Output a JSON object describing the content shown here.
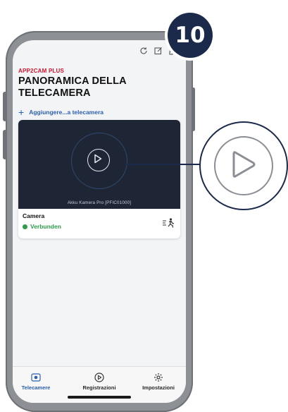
{
  "step_number": "10",
  "toolbar": {
    "icons": [
      "refresh-icon",
      "edit-icon",
      "grid-icon"
    ]
  },
  "header": {
    "app_name": "APP2CAM PLUS",
    "title": "PANORAMICA DELLA TELECAMERA"
  },
  "add_camera": {
    "label": "Aggiungere...a telecamera"
  },
  "camera_card": {
    "preview_caption": "Akku Kamera Pro [PFIC01000]",
    "name": "Camera",
    "status": "Verbunden"
  },
  "bottom_nav": {
    "items": [
      {
        "label": "Telecamere",
        "icon": "camera-icon",
        "active": true
      },
      {
        "label": "Registrazioni",
        "icon": "play-circle-icon",
        "active": false
      },
      {
        "label": "Impostazioni",
        "icon": "gear-icon",
        "active": false
      }
    ]
  },
  "colors": {
    "accent": "#2b5fae",
    "brand_red": "#d2142d",
    "status_green": "#2e9c48",
    "badge_navy": "#1b2a4a"
  }
}
